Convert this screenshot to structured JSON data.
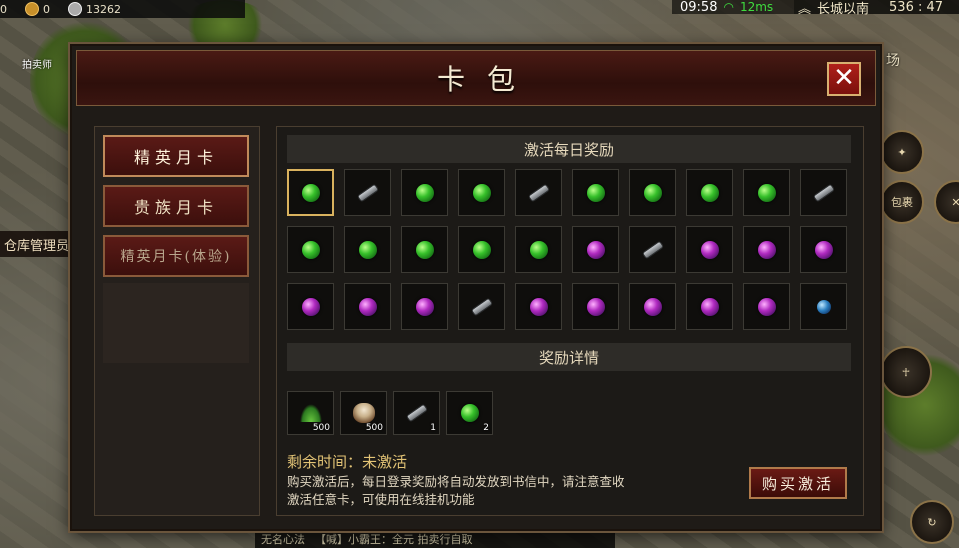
{
  "hud": {
    "gold": "0",
    "ingot": "0",
    "silver": "13262",
    "time": "09:58",
    "ping": "12ms",
    "map_name": "长城以南",
    "coords": "536 : 47",
    "npc_label": "拍卖师",
    "warehouse": "仓库管理员",
    "right_label_1": "场",
    "right_label_2": "包裹",
    "chat_channel": "【喊】小霸王：全元 拍卖行自取",
    "chat_status": "无名心法"
  },
  "dialog": {
    "title": "卡包",
    "close_label": "✕",
    "tabs": [
      {
        "label": "精英月卡"
      },
      {
        "label": "贵族月卡"
      },
      {
        "label": "精英月卡(体验)"
      }
    ],
    "daily_header": "激活每日奖励",
    "daily_grid": [
      [
        "green",
        "scroll",
        "green",
        "green",
        "scroll",
        "green",
        "green",
        "green",
        "green",
        "scroll"
      ],
      [
        "green",
        "green",
        "green",
        "green",
        "green",
        "purple",
        "scroll",
        "purple",
        "purple",
        "purple"
      ],
      [
        "purple",
        "purple",
        "purple",
        "scroll",
        "purple",
        "purple",
        "purple",
        "purple",
        "purple",
        "blue"
      ]
    ],
    "detail_header": "奖励详情",
    "rewards": [
      {
        "icon": "grass",
        "count": "500"
      },
      {
        "icon": "drum",
        "count": "500"
      },
      {
        "icon": "scroll",
        "count": "1"
      },
      {
        "icon": "green",
        "count": "2"
      }
    ],
    "remaining_label": "剩余时间：",
    "remaining_value": "未激活",
    "desc_line1": "购买激活后，每日登录奖励将自动发放到书信中，请注意查收",
    "desc_line2": "激活任意卡，可使用在线挂机功能",
    "buy_label": "购买激活"
  }
}
